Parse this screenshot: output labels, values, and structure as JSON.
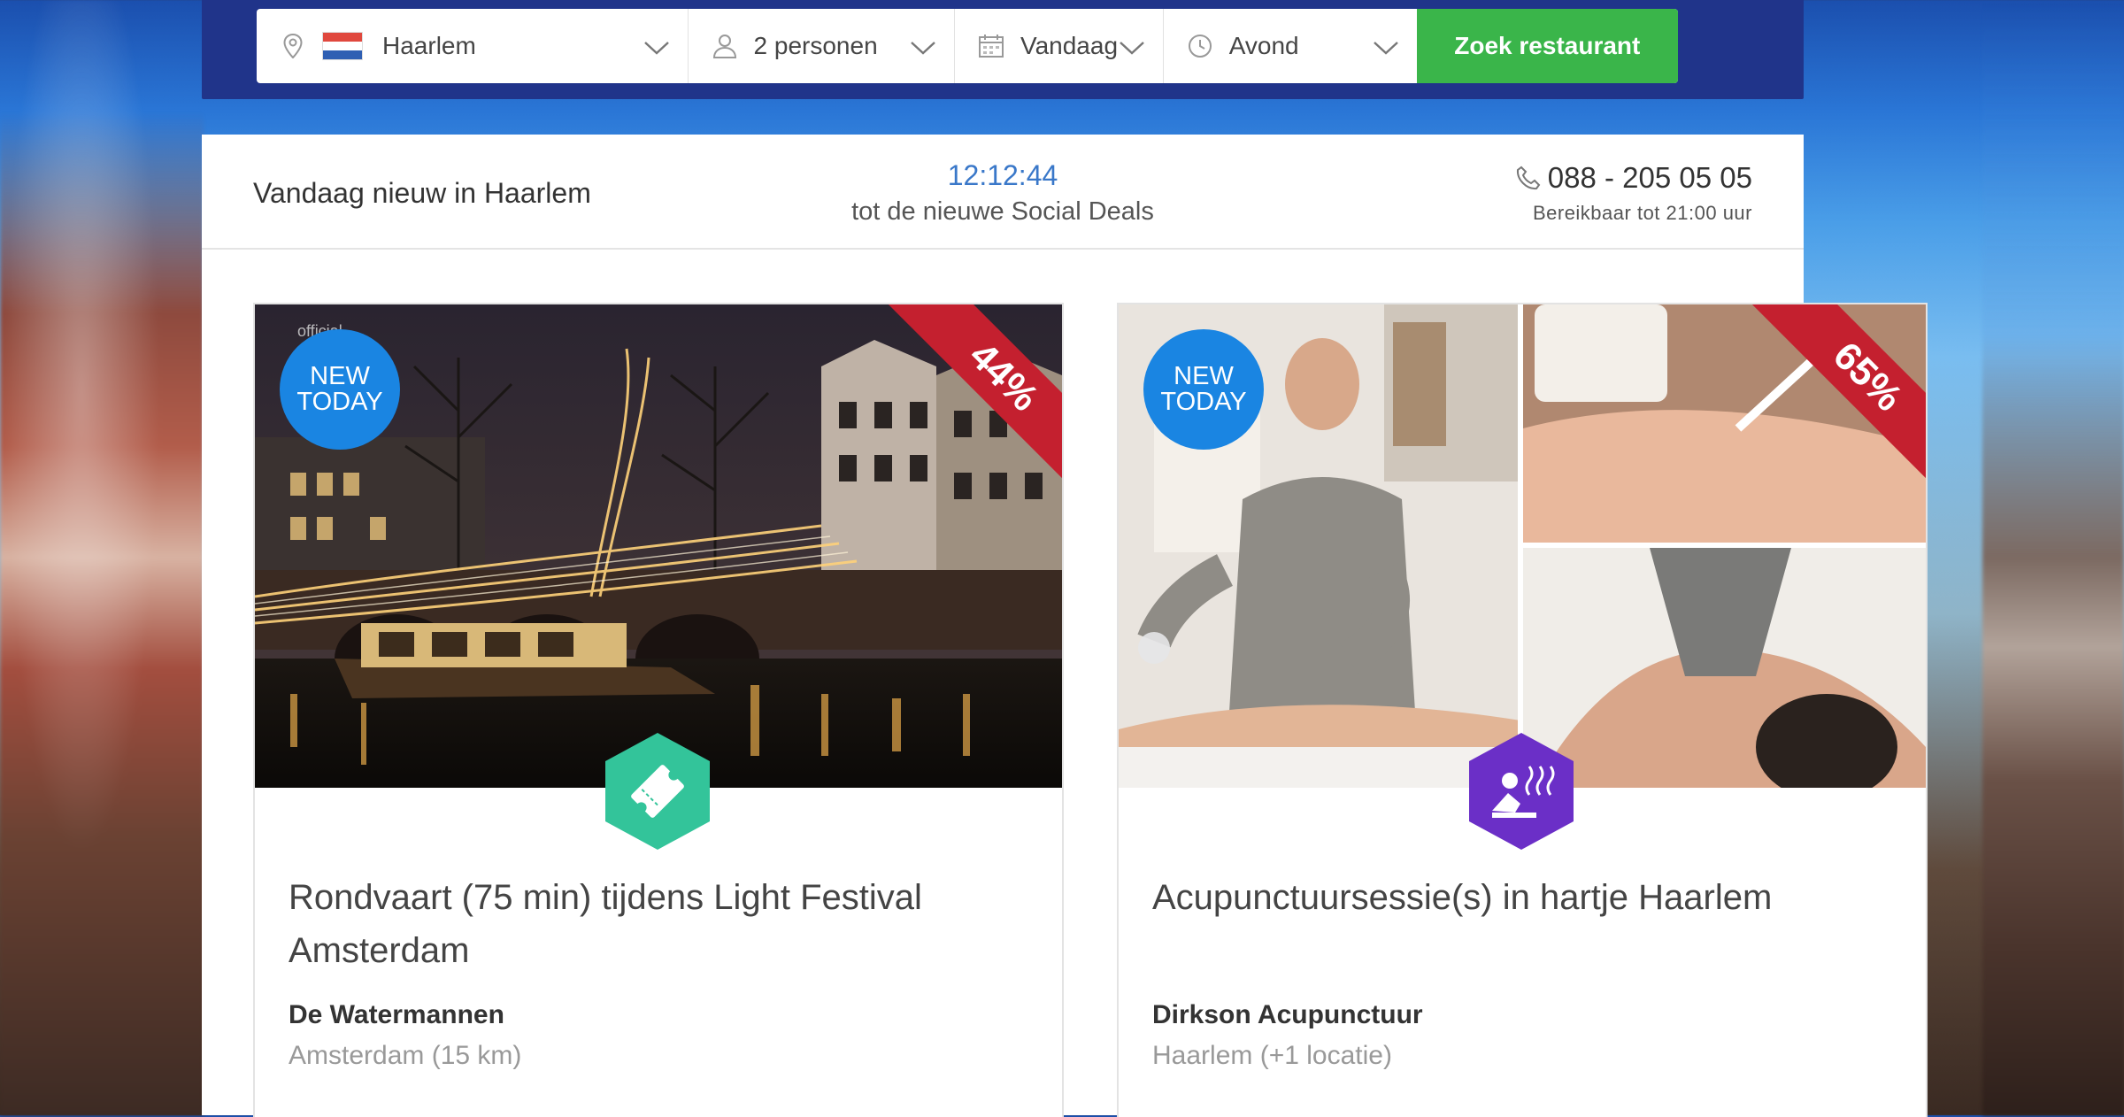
{
  "search": {
    "city": "Haarlem",
    "persons": "2 personen",
    "date": "Vandaag",
    "time": "Avond",
    "submit_label": "Zoek restaurant"
  },
  "infobar": {
    "heading": "Vandaag nieuw in Haarlem",
    "timer": "12:12:44",
    "timer_caption": "tot de nieuwe Social Deals",
    "phone": "088 - 205 05 05",
    "hours": "Bereikbaar tot 21:00 uur"
  },
  "deals": [
    {
      "badge_line1": "NEW",
      "badge_line2": "TODAY",
      "discount": "44%",
      "category_icon": "ticket-icon",
      "category_color": "#33c49a",
      "photo_watermark": "official",
      "title": "Rondvaart (75 min) tijdens Light Festival Amsterdam",
      "company": "De Watermannen",
      "location": "Amsterdam (15 km)"
    },
    {
      "badge_line1": "NEW",
      "badge_line2": "TODAY",
      "discount": "65%",
      "category_icon": "wellness-icon",
      "category_color": "#6b2fc7",
      "title": "Acupunctuursessie(s) in hartje Haarlem",
      "company": "Dirkson Acupunctuur",
      "location": "Haarlem (+1 locatie)"
    }
  ],
  "colors": {
    "navbar": "#20348a",
    "search_button": "#3ab54a",
    "new_badge": "#1a85e2",
    "discount_ribbon": "#c4202f",
    "timer": "#3a78c9"
  }
}
